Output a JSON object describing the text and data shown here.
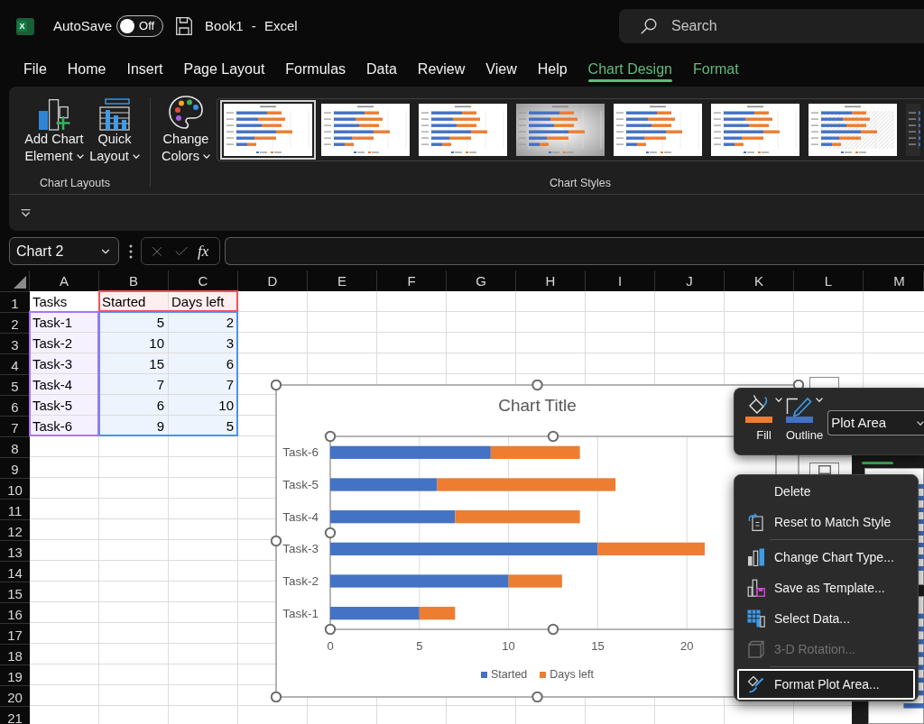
{
  "title_bar": {
    "logo_letter": "X",
    "autosave": {
      "label": "AutoSave",
      "on": false,
      "state_text": "Off"
    },
    "document_title": "Book1 - Excel",
    "search": {
      "placeholder": "Search"
    }
  },
  "tabs": [
    {
      "label": "File",
      "selected": false,
      "contextual": false
    },
    {
      "label": "Home",
      "selected": false,
      "contextual": false
    },
    {
      "label": "Insert",
      "selected": false,
      "contextual": false
    },
    {
      "label": "Page Layout",
      "selected": false,
      "contextual": false
    },
    {
      "label": "Formulas",
      "selected": false,
      "contextual": false
    },
    {
      "label": "Data",
      "selected": false,
      "contextual": false
    },
    {
      "label": "Review",
      "selected": false,
      "contextual": false
    },
    {
      "label": "View",
      "selected": false,
      "contextual": false
    },
    {
      "label": "Help",
      "selected": false,
      "contextual": false
    },
    {
      "label": "Chart Design",
      "selected": true,
      "contextual": true
    },
    {
      "label": "Format",
      "selected": false,
      "contextual": true
    }
  ],
  "ribbon": {
    "groups": [
      {
        "label": "Chart Layouts",
        "buttons": [
          {
            "kind": "element",
            "lines": [
              "Add Chart",
              "Element"
            ],
            "has_menu": true
          },
          {
            "kind": "layout",
            "lines": [
              "Quick",
              "Layout"
            ],
            "has_menu": true
          }
        ]
      },
      {
        "label": "Chart Styles",
        "buttons": [
          {
            "kind": "colors",
            "lines": [
              "Change",
              "Colors"
            ],
            "has_menu": true
          }
        ],
        "styles": [
          {
            "kind": "light",
            "selected": true
          },
          {
            "kind": "light",
            "selected": false
          },
          {
            "kind": "light",
            "selected": false
          },
          {
            "kind": "shaded",
            "selected": false
          },
          {
            "kind": "light",
            "selected": false
          },
          {
            "kind": "light",
            "selected": false
          },
          {
            "kind": "pattern",
            "selected": false
          },
          {
            "kind": "dark",
            "selected": false
          }
        ]
      }
    ]
  },
  "formula_bar": {
    "name_box": "Chart 2",
    "edit_buttons_enabled": false,
    "function_label": "fx"
  },
  "sheet": {
    "columns": [
      "A",
      "B",
      "C",
      "D",
      "E",
      "F",
      "G",
      "H",
      "I",
      "J",
      "K",
      "L",
      "M"
    ],
    "highlights": [
      {
        "kind": "name",
        "color": "#f0555a"
      },
      {
        "kind": "category",
        "color": "#a972ff"
      },
      {
        "kind": "value",
        "color": "#4e8ff0"
      }
    ],
    "rows": [
      {
        "number": "1",
        "cells": [
          {
            "text": "Tasks",
            "kind": "plain"
          },
          {
            "text": "Started",
            "kind": "name"
          },
          {
            "text": "Days left",
            "kind": "name"
          }
        ]
      },
      {
        "number": "2",
        "cells": [
          {
            "text": "Task-1",
            "kind": "category"
          },
          {
            "text": "5",
            "kind": "value"
          },
          {
            "text": "2",
            "kind": "value"
          }
        ]
      },
      {
        "number": "3",
        "cells": [
          {
            "text": "Task-2",
            "kind": "category"
          },
          {
            "text": "10",
            "kind": "value"
          },
          {
            "text": "3",
            "kind": "value"
          }
        ]
      },
      {
        "number": "4",
        "cells": [
          {
            "text": "Task-3",
            "kind": "category"
          },
          {
            "text": "15",
            "kind": "value"
          },
          {
            "text": "6",
            "kind": "value"
          }
        ]
      },
      {
        "number": "5",
        "cells": [
          {
            "text": "Task-4",
            "kind": "category"
          },
          {
            "text": "7",
            "kind": "value"
          },
          {
            "text": "7",
            "kind": "value"
          }
        ]
      },
      {
        "number": "6",
        "cells": [
          {
            "text": "Task-5",
            "kind": "category"
          },
          {
            "text": "6",
            "kind": "value"
          },
          {
            "text": "10",
            "kind": "value"
          }
        ]
      },
      {
        "number": "7",
        "cells": [
          {
            "text": "Task-6",
            "kind": "category"
          },
          {
            "text": "9",
            "kind": "value"
          },
          {
            "text": "5",
            "kind": "value"
          }
        ]
      },
      {
        "number": "8"
      },
      {
        "number": "9"
      },
      {
        "number": "10"
      },
      {
        "number": "11"
      },
      {
        "number": "12"
      },
      {
        "number": "13"
      },
      {
        "number": "14"
      },
      {
        "number": "15"
      },
      {
        "number": "16"
      },
      {
        "number": "17"
      },
      {
        "number": "18"
      },
      {
        "number": "19"
      },
      {
        "number": "20"
      },
      {
        "number": "21"
      }
    ]
  },
  "chart": {
    "selected": true,
    "plot_area_selected": true,
    "chart_data": {
      "type": "bar",
      "orientation": "horizontal",
      "stacked": true,
      "title": "Chart Title",
      "categories": [
        "Task-6",
        "Task-5",
        "Task-4",
        "Task-3",
        "Task-2",
        "Task-1"
      ],
      "series": [
        {
          "name": "Started",
          "color": "#4472c4",
          "values": [
            9,
            6,
            7,
            15,
            10,
            5
          ]
        },
        {
          "name": "Days left",
          "color": "#ed7d31",
          "values": [
            5,
            10,
            7,
            6,
            3,
            2
          ]
        }
      ],
      "xlim": [
        0,
        25
      ],
      "xticks": [
        {
          "value": 0,
          "label": "0"
        },
        {
          "value": 5,
          "label": "5"
        },
        {
          "value": 10,
          "label": "10"
        },
        {
          "value": 15,
          "label": "15"
        },
        {
          "value": 20,
          "label": "20"
        }
      ],
      "grid": true,
      "legend": true
    }
  },
  "mini_toolbar": {
    "buttons": [
      {
        "kind": "fill",
        "label": "Fill",
        "color": "#ed7d31"
      },
      {
        "kind": "outline",
        "label": "Outline",
        "color": "#4472c4"
      }
    ],
    "element": "Plot Area"
  },
  "context_menu": {
    "sections": [
      {
        "items": [
          {
            "kind": "delete",
            "label": "Delete",
            "disabled": false,
            "selected": false
          },
          {
            "kind": "reset",
            "label": "Reset to Match Style",
            "disabled": false,
            "selected": false
          }
        ]
      },
      {
        "items": [
          {
            "kind": "charttype",
            "label": "Change Chart Type...",
            "disabled": false,
            "selected": false
          },
          {
            "kind": "template",
            "label": "Save as Template...",
            "disabled": false,
            "selected": false
          },
          {
            "kind": "selectdata",
            "label": "Select Data...",
            "disabled": false,
            "selected": false
          },
          {
            "kind": "rotation",
            "label": "3-D Rotation...",
            "disabled": true,
            "selected": false
          }
        ]
      },
      {
        "items": [
          {
            "kind": "format",
            "label": "Format Plot Area...",
            "disabled": false,
            "selected": true
          }
        ]
      }
    ]
  }
}
